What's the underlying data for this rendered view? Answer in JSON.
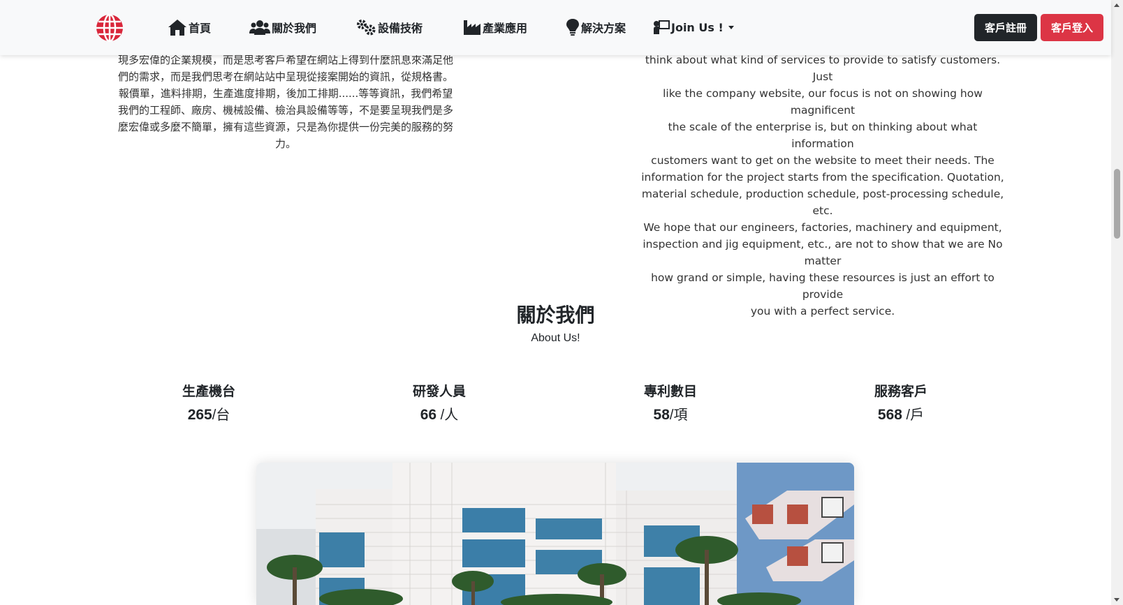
{
  "nav": {
    "items": [
      {
        "label": "首頁",
        "icon": "home-icon"
      },
      {
        "label": "關於我們",
        "icon": "users-icon"
      },
      {
        "label": "設備技術",
        "icon": "gears-icon"
      },
      {
        "label": "產業應用",
        "icon": "industry-icon"
      },
      {
        "label": "解決方案",
        "icon": "lightbulb-icon"
      },
      {
        "label": "Join Us !",
        "icon": "person-chalkboard-icon"
      }
    ],
    "register_label": "客戶註冊",
    "login_label": "客戶登入",
    "logo_icon": "globe-icon"
  },
  "intro": {
    "left_lines": [
      "現多宏偉的企業規模，而是思考客戶希望在網站上得到什麼訊息來滿足他",
      "們的需求，而是我們思考在網站站中呈現從接案開始的資訊，從規格書。",
      "報價單，進料排期，生產進度排期，後加工排期......等等資訊，我們希望",
      "我們的工程師、廠房、機械設備、檢治具設備等等，不是要呈現我們是多",
      "麼宏偉或多麼不簡單，擁有這些資源，只是為你提供一份完美的服務的努",
      "力。"
    ],
    "right_lines": [
      "think about what kind of services to provide to satisfy customers. Just",
      "like the company website, our focus is not on showing how magnificent",
      "the scale of the enterprise is, but on thinking about what information",
      "customers want to get on the website to meet their needs. The",
      "information for the project starts from the specification. Quotation,",
      "material schedule, production schedule, post-processing schedule, etc.",
      "We hope that our engineers, factories, machinery and equipment,",
      "inspection and jig equipment, etc., are not to show that we are No matter",
      "how grand or simple, having these resources is just an effort to provide",
      "you with a perfect service."
    ]
  },
  "about": {
    "title": "關於我們",
    "subtitle": "About Us!"
  },
  "stats": [
    {
      "label": "生產機台",
      "value": "265",
      "unit": "/台"
    },
    {
      "label": "研發人員",
      "value": "66",
      "unit": " /人"
    },
    {
      "label": "專利數目",
      "value": "58",
      "unit": "/項"
    },
    {
      "label": "服務客戶",
      "value": "568",
      "unit": " /戶"
    }
  ],
  "colors": {
    "accent_red": "#dc3545",
    "dark": "#212529",
    "navbar_bg": "#f8f9fa"
  }
}
